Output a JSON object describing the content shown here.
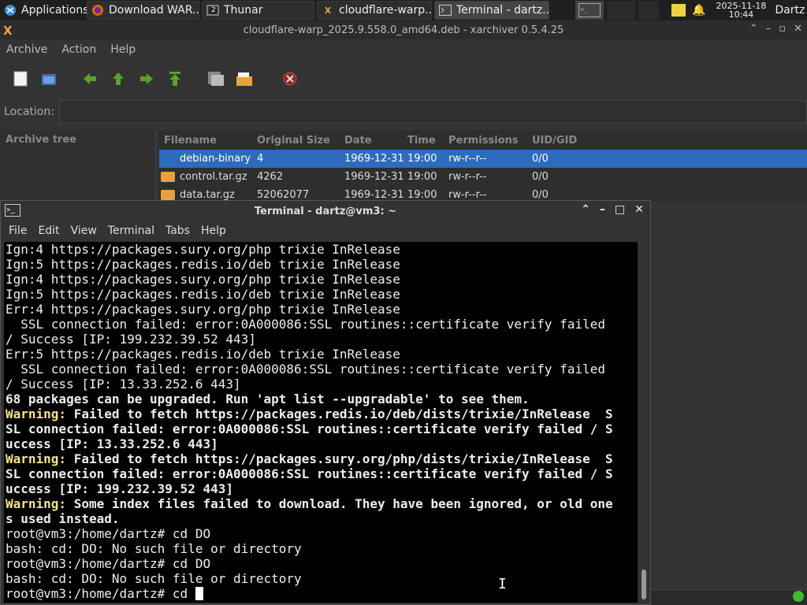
{
  "panel": {
    "applications_label": "Applications",
    "tasks": [
      {
        "label": "Download WAR..."
      },
      {
        "label": "Thunar",
        "badge": "2"
      },
      {
        "label": "cloudflare-warp..."
      },
      {
        "label": "Terminal - dartz..."
      }
    ],
    "clock_date": "2025-11-18",
    "clock_time": "10:44",
    "user": "Dartz"
  },
  "xarchiver": {
    "title": "cloudflare-warp_2025.9.558.0_amd64.deb - xarchiver 0.5.4.25",
    "menu": [
      "Archive",
      "Action",
      "Help"
    ],
    "location_label": "Location:",
    "location_value": "",
    "archive_tree_label": "Archive tree",
    "columns": [
      "Filename",
      "Original Size",
      "Date",
      "Time",
      "Permissions",
      "UID/GID"
    ],
    "rows": [
      {
        "name": "debian-binary",
        "size": "4",
        "date": "1969-12-31",
        "time": "19:00",
        "perm": "rw-r--r--",
        "uid": "0/0",
        "selected": true
      },
      {
        "name": "control.tar.gz",
        "size": "4262",
        "date": "1969-12-31",
        "time": "19:00",
        "perm": "rw-r--r--",
        "uid": "0/0",
        "selected": false
      },
      {
        "name": "data.tar.gz",
        "size": "52062077",
        "date": "1969-12-31",
        "time": "19:00",
        "perm": "rw-r--r--",
        "uid": "0/0",
        "selected": false
      }
    ]
  },
  "terminal": {
    "title": "Terminal - dartz@vm3: ~",
    "menu": [
      "File",
      "Edit",
      "View",
      "Terminal",
      "Tabs",
      "Help"
    ],
    "lines": [
      {
        "t": "Ign:4 https://packages.sury.org/php trixie InRelease"
      },
      {
        "t": "Ign:5 https://packages.redis.io/deb trixie InRelease"
      },
      {
        "t": "Ign:4 https://packages.sury.org/php trixie InRelease"
      },
      {
        "t": "Ign:5 https://packages.redis.io/deb trixie InRelease"
      },
      {
        "t": "Err:4 https://packages.sury.org/php trixie InRelease"
      },
      {
        "t": "  SSL connection failed: error:0A000086:SSL routines::certificate verify failed"
      },
      {
        "t": "/ Success [IP: 199.232.39.52 443]"
      },
      {
        "t": "Err:5 https://packages.redis.io/deb trixie InRelease"
      },
      {
        "t": "  SSL connection failed: error:0A000086:SSL routines::certificate verify failed"
      },
      {
        "t": "/ Success [IP: 13.33.252.6 443]"
      },
      {
        "t": "68 packages can be upgraded. Run 'apt list --upgradable' to see them.",
        "bold": true
      },
      {
        "w": "Warning:",
        "t": " Failed to fetch https://packages.redis.io/deb/dists/trixie/InRelease  S",
        "bold": true
      },
      {
        "t": "SL connection failed: error:0A000086:SSL routines::certificate verify failed / S",
        "bold": true
      },
      {
        "t": "uccess [IP: 13.33.252.6 443]",
        "bold": true
      },
      {
        "w": "Warning:",
        "t": " Failed to fetch https://packages.sury.org/php/dists/trixie/InRelease  S",
        "bold": true
      },
      {
        "t": "SL connection failed: error:0A000086:SSL routines::certificate verify failed / S",
        "bold": true
      },
      {
        "t": "uccess [IP: 199.232.39.52 443]",
        "bold": true
      },
      {
        "w": "Warning:",
        "t": " Some index files failed to download. They have been ignored, or old one",
        "bold": true
      },
      {
        "t": "s used instead.",
        "bold": true
      },
      {
        "t": "root@vm3:/home/dartz# cd DO"
      },
      {
        "t": "bash: cd: DO: No such file or directory"
      },
      {
        "t": "root@vm3:/home/dartz# cd DO"
      },
      {
        "t": "bash: cd: DO: No such file or directory"
      }
    ],
    "prompt_line": "root@vm3:/home/dartz# cd "
  }
}
